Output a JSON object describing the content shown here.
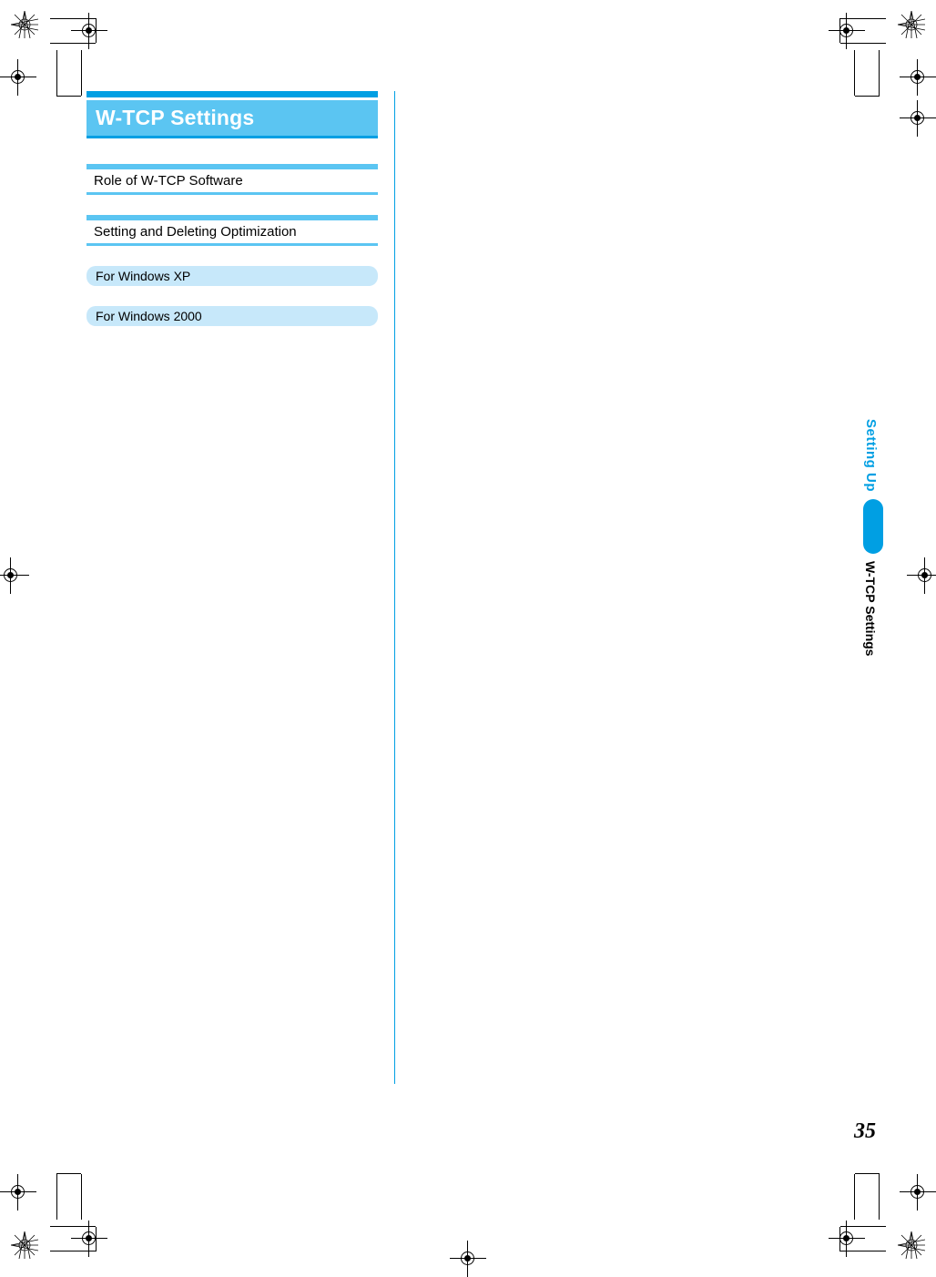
{
  "section_title": "W-TCP Settings",
  "subsections": [
    "Role of W-TCP Software",
    "Setting and Deleting Optimization"
  ],
  "os_items": [
    "For Windows XP",
    "For Windows 2000"
  ],
  "side_tab": {
    "category": "Setting Up",
    "topic": "W-TCP Settings"
  },
  "page_number": "35"
}
